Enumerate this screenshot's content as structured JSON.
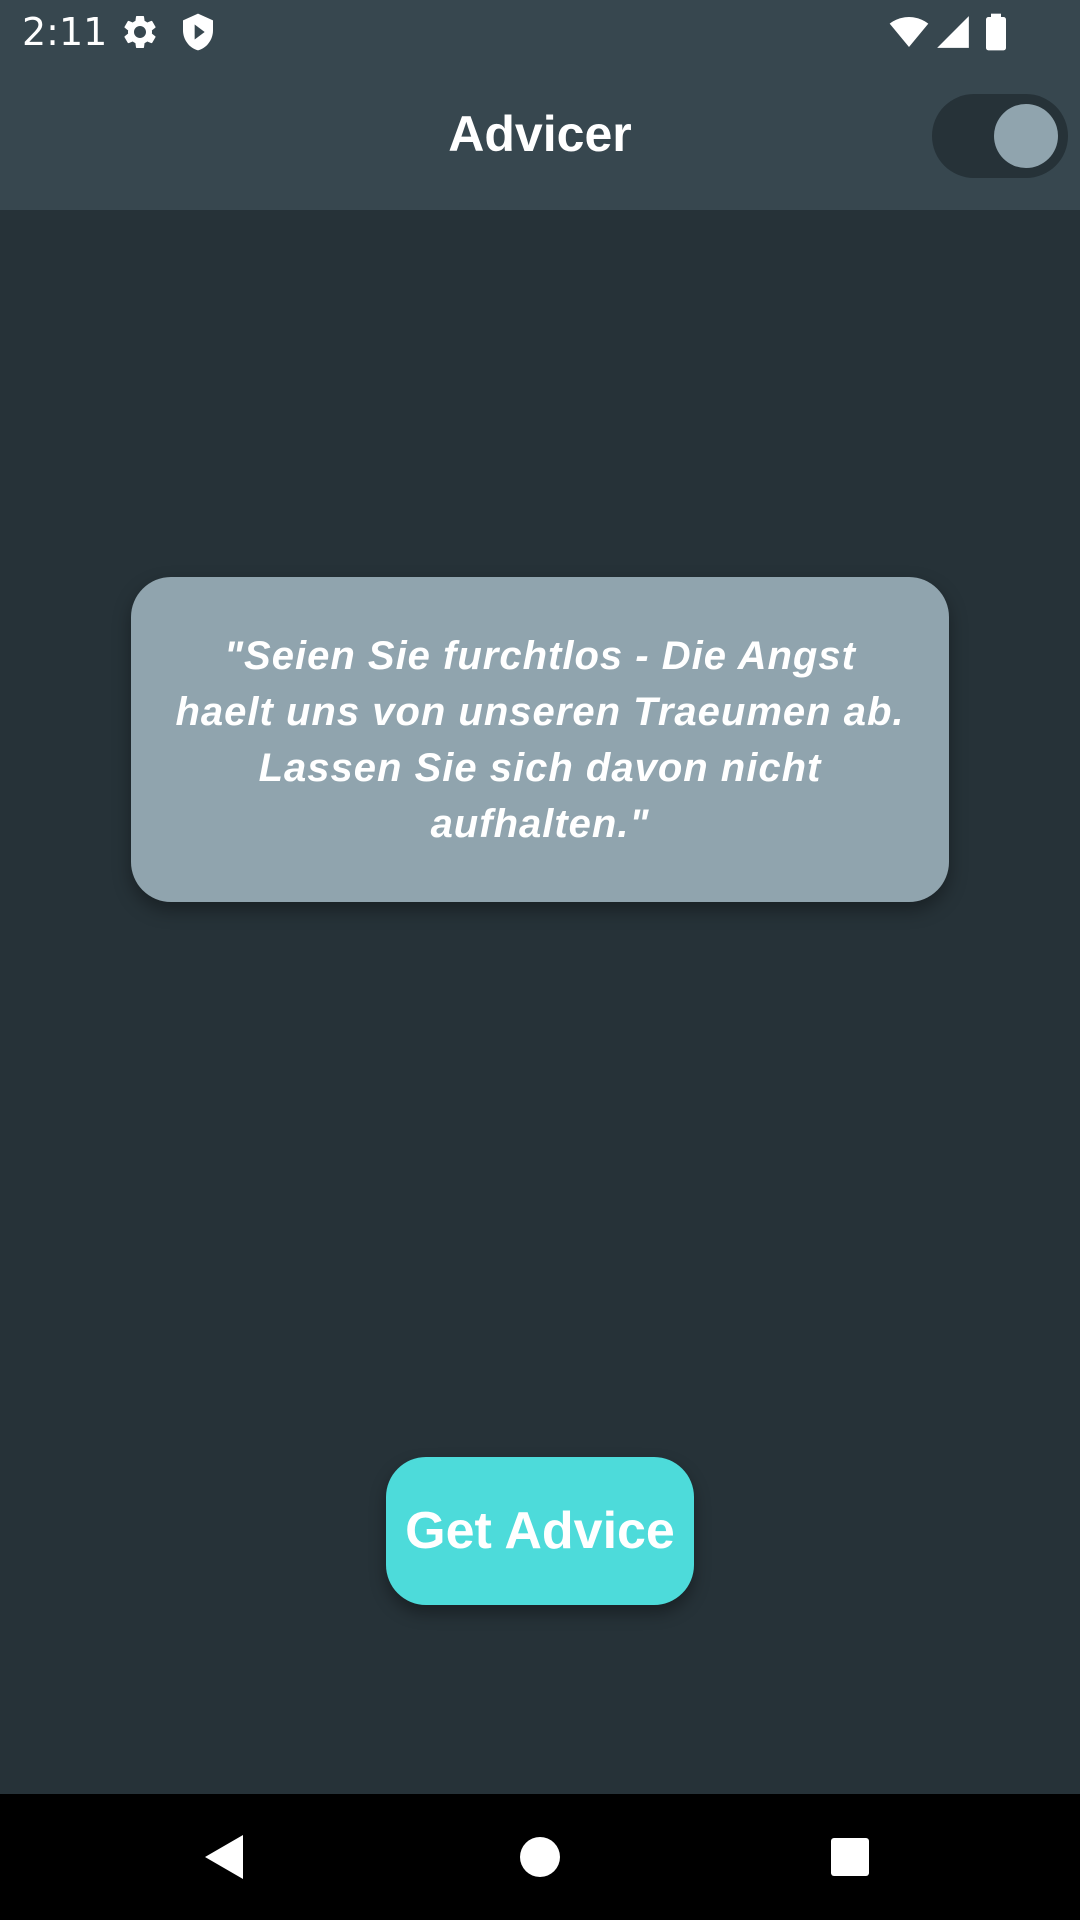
{
  "status_bar": {
    "time": "2:11",
    "icons": [
      "gear-icon",
      "shield-icon",
      "wifi-icon",
      "signal-icon",
      "battery-icon"
    ]
  },
  "app_bar": {
    "title": "Advicer",
    "theme_toggle": {
      "on": true
    }
  },
  "advice": {
    "text": "\"Seien Sie furchtlos - Die Angst haelt uns von unseren Traeumen ab. Lassen Sie sich davon nicht aufhalten.\""
  },
  "actions": {
    "get_advice_label": "Get Advice"
  },
  "nav_bar": {
    "icons": [
      "back-icon",
      "home-icon",
      "recents-icon"
    ]
  },
  "colors": {
    "app_bar": "#37474f",
    "background": "#263238",
    "card": "#90a4ae",
    "accent": "#4ddbda"
  }
}
